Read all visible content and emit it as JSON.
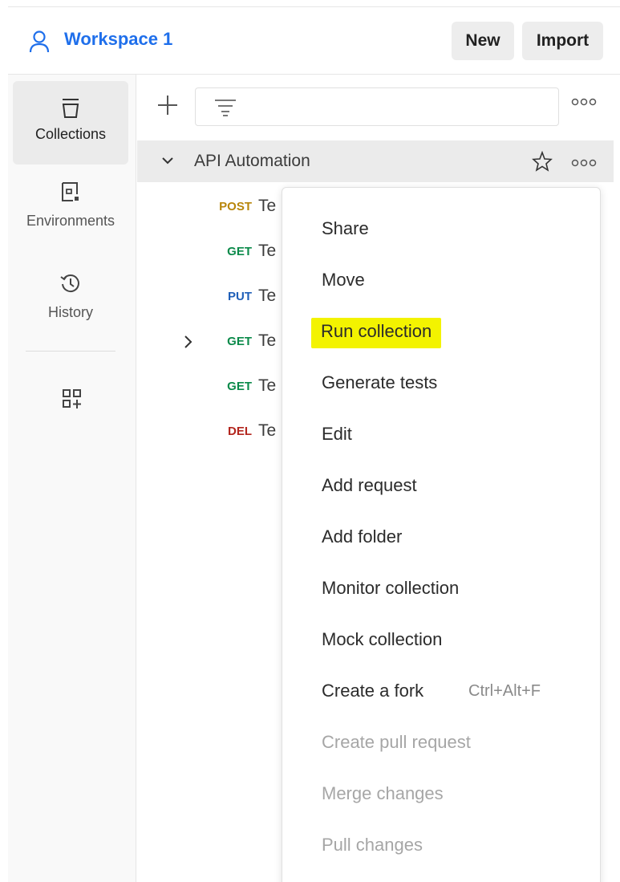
{
  "header": {
    "workspace_name": "Workspace 1",
    "new_label": "New",
    "import_label": "Import"
  },
  "rail": {
    "items": [
      {
        "label": "Collections",
        "icon": "collections-icon",
        "active": true
      },
      {
        "label": "Environments",
        "icon": "environments-icon",
        "active": false
      },
      {
        "label": "History",
        "icon": "history-icon",
        "active": false
      }
    ],
    "add_icon": "add-apps-icon"
  },
  "sidebar": {
    "collection_name": "API Automation",
    "requests": [
      {
        "method": "POST",
        "name": "Te"
      },
      {
        "method": "GET",
        "name": "Te"
      },
      {
        "method": "PUT",
        "name": "Te"
      },
      {
        "method": "GET",
        "name": "Te",
        "expandable": true
      },
      {
        "method": "GET",
        "name": "Te"
      },
      {
        "method": "DEL",
        "name": "Te"
      }
    ]
  },
  "menu": {
    "items": [
      {
        "label": "Share",
        "enabled": true
      },
      {
        "label": "Move",
        "enabled": true
      },
      {
        "label": "Run collection",
        "enabled": true,
        "highlighted": true
      },
      {
        "label": "Generate tests",
        "enabled": true
      },
      {
        "label": "Edit",
        "enabled": true
      },
      {
        "label": "Add request",
        "enabled": true
      },
      {
        "label": "Add folder",
        "enabled": true
      },
      {
        "label": "Monitor collection",
        "enabled": true
      },
      {
        "label": "Mock collection",
        "enabled": true
      },
      {
        "label": "Create a fork",
        "enabled": true,
        "shortcut": "Ctrl+Alt+F"
      },
      {
        "label": "Create pull request",
        "enabled": false
      },
      {
        "label": "Merge changes",
        "enabled": false
      },
      {
        "label": "Pull changes",
        "enabled": false
      }
    ]
  },
  "colors": {
    "accent": "#1f6feb",
    "highlight": "#f3f300",
    "post": "#b8860b",
    "get": "#0b8a4a",
    "put": "#1f5fb8",
    "del": "#b3261e"
  }
}
